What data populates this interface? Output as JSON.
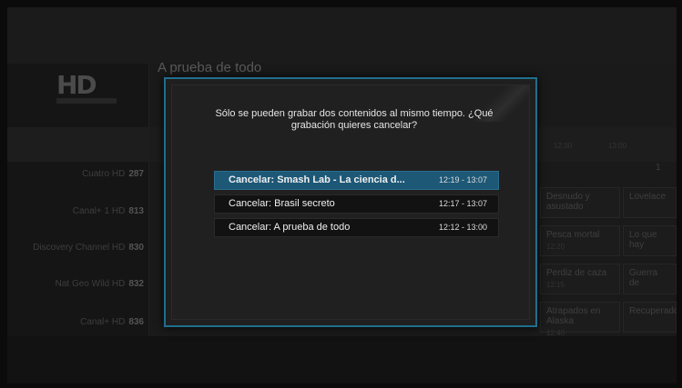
{
  "background": {
    "logo_text": "HD",
    "title": "A prueba de todo",
    "channels": [
      {
        "name": "Cuatro HD",
        "number": "287"
      },
      {
        "name": "Canal+ 1 HD",
        "number": "813"
      },
      {
        "name": "Discovery Channel HD",
        "number": "830"
      },
      {
        "name": "Nat Geo Wild HD",
        "number": "832"
      },
      {
        "name": "Canal+ HD",
        "number": "836"
      }
    ],
    "programs": [
      {
        "title": "Desnudo y asustado",
        "time": ""
      },
      {
        "title": "Pesca mortal",
        "time": "12:20"
      },
      {
        "title": "Perdiz de caza",
        "time": "12:15"
      },
      {
        "title": "Atrapados en Alaska",
        "time": "12:40"
      },
      {
        "title": "Lovelace",
        "time": ""
      },
      {
        "title": "Lo que hay",
        "time": ""
      },
      {
        "title": "Guerra de",
        "time": ""
      },
      {
        "title": "Recuperados",
        "time": ""
      }
    ],
    "right_label": "1",
    "band_times": [
      "12:30",
      "13:00"
    ]
  },
  "dialog": {
    "message": "Sólo se pueden grabar dos contenidos al mismo tiempo. ¿Qué grabación quieres cancelar?",
    "options": [
      {
        "label": "Cancelar: Smash Lab - La ciencia d...",
        "time": "12:19 - 13:07",
        "selected": true
      },
      {
        "label": "Cancelar: Brasil secreto",
        "time": "12:17 - 13:07",
        "selected": false
      },
      {
        "label": "Cancelar: A prueba de todo",
        "time": "12:12 - 13:00",
        "selected": false
      }
    ]
  },
  "colors": {
    "dialog_border": "#1f6f8d",
    "selected_option": "#1d5876",
    "option_bg": "#121212"
  }
}
